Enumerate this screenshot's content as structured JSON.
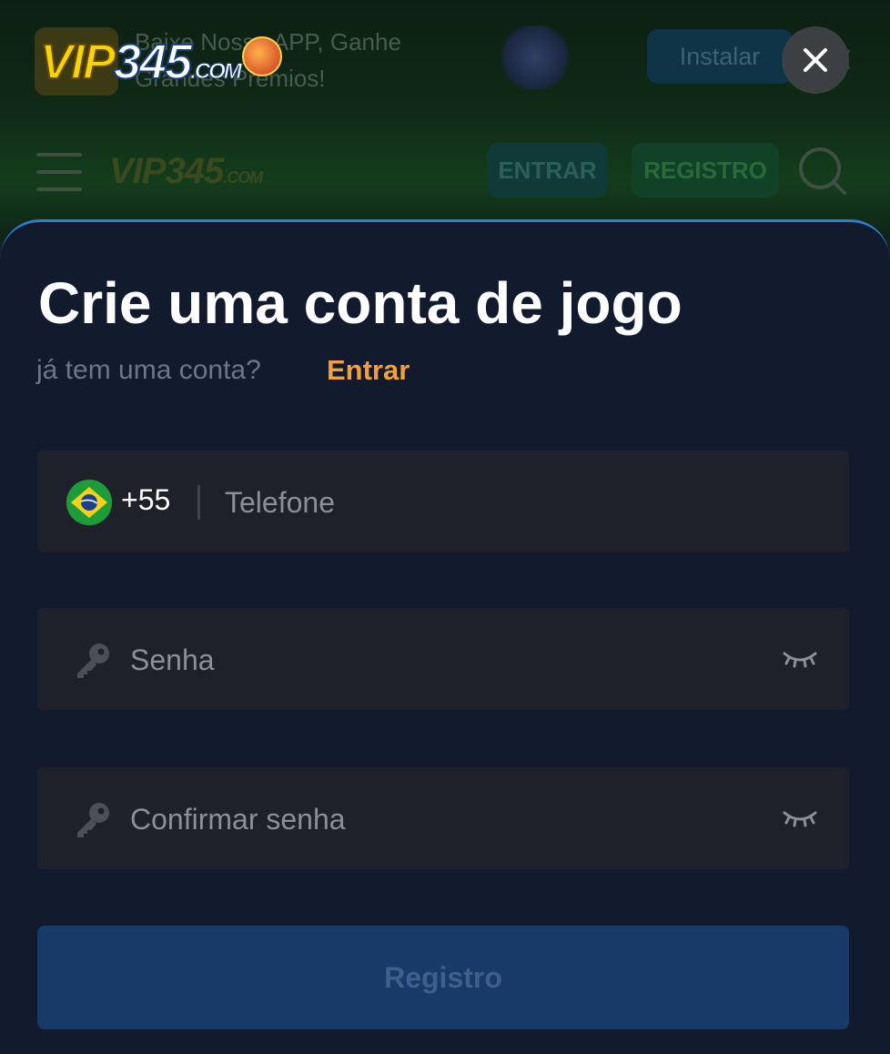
{
  "app_banner": {
    "text": "Baixe Nosso APP, Ganhe Grandes Prêmios!",
    "install_label": "Instalar"
  },
  "brand": {
    "logo_main": "VIP",
    "logo_num": "345",
    "logo_suffix": ".COM"
  },
  "nav": {
    "login_label": "ENTRAR",
    "register_label": "REGISTRO"
  },
  "modal": {
    "title": "Crie uma conta de jogo",
    "subtitle": "já tem uma conta?",
    "login_link": "Entrar",
    "phone": {
      "country_code": "+55",
      "country_flag": "brazil-flag-icon",
      "placeholder": "Telefone"
    },
    "password": {
      "placeholder": "Senha"
    },
    "confirm_password": {
      "placeholder": "Confirmar senha"
    },
    "submit_label": "Registro"
  },
  "colors": {
    "sheet_bg": "#111b2d",
    "field_bg": "#1e2129",
    "accent_link": "#f0a03c",
    "submit_bg": "#173a68",
    "sheet_border": "#2c7fd1"
  },
  "icons": {
    "close": "close-icon",
    "key": "key-icon",
    "eye_hidden": "eye-closed-icon",
    "menu": "hamburger-icon",
    "search": "search-icon"
  }
}
